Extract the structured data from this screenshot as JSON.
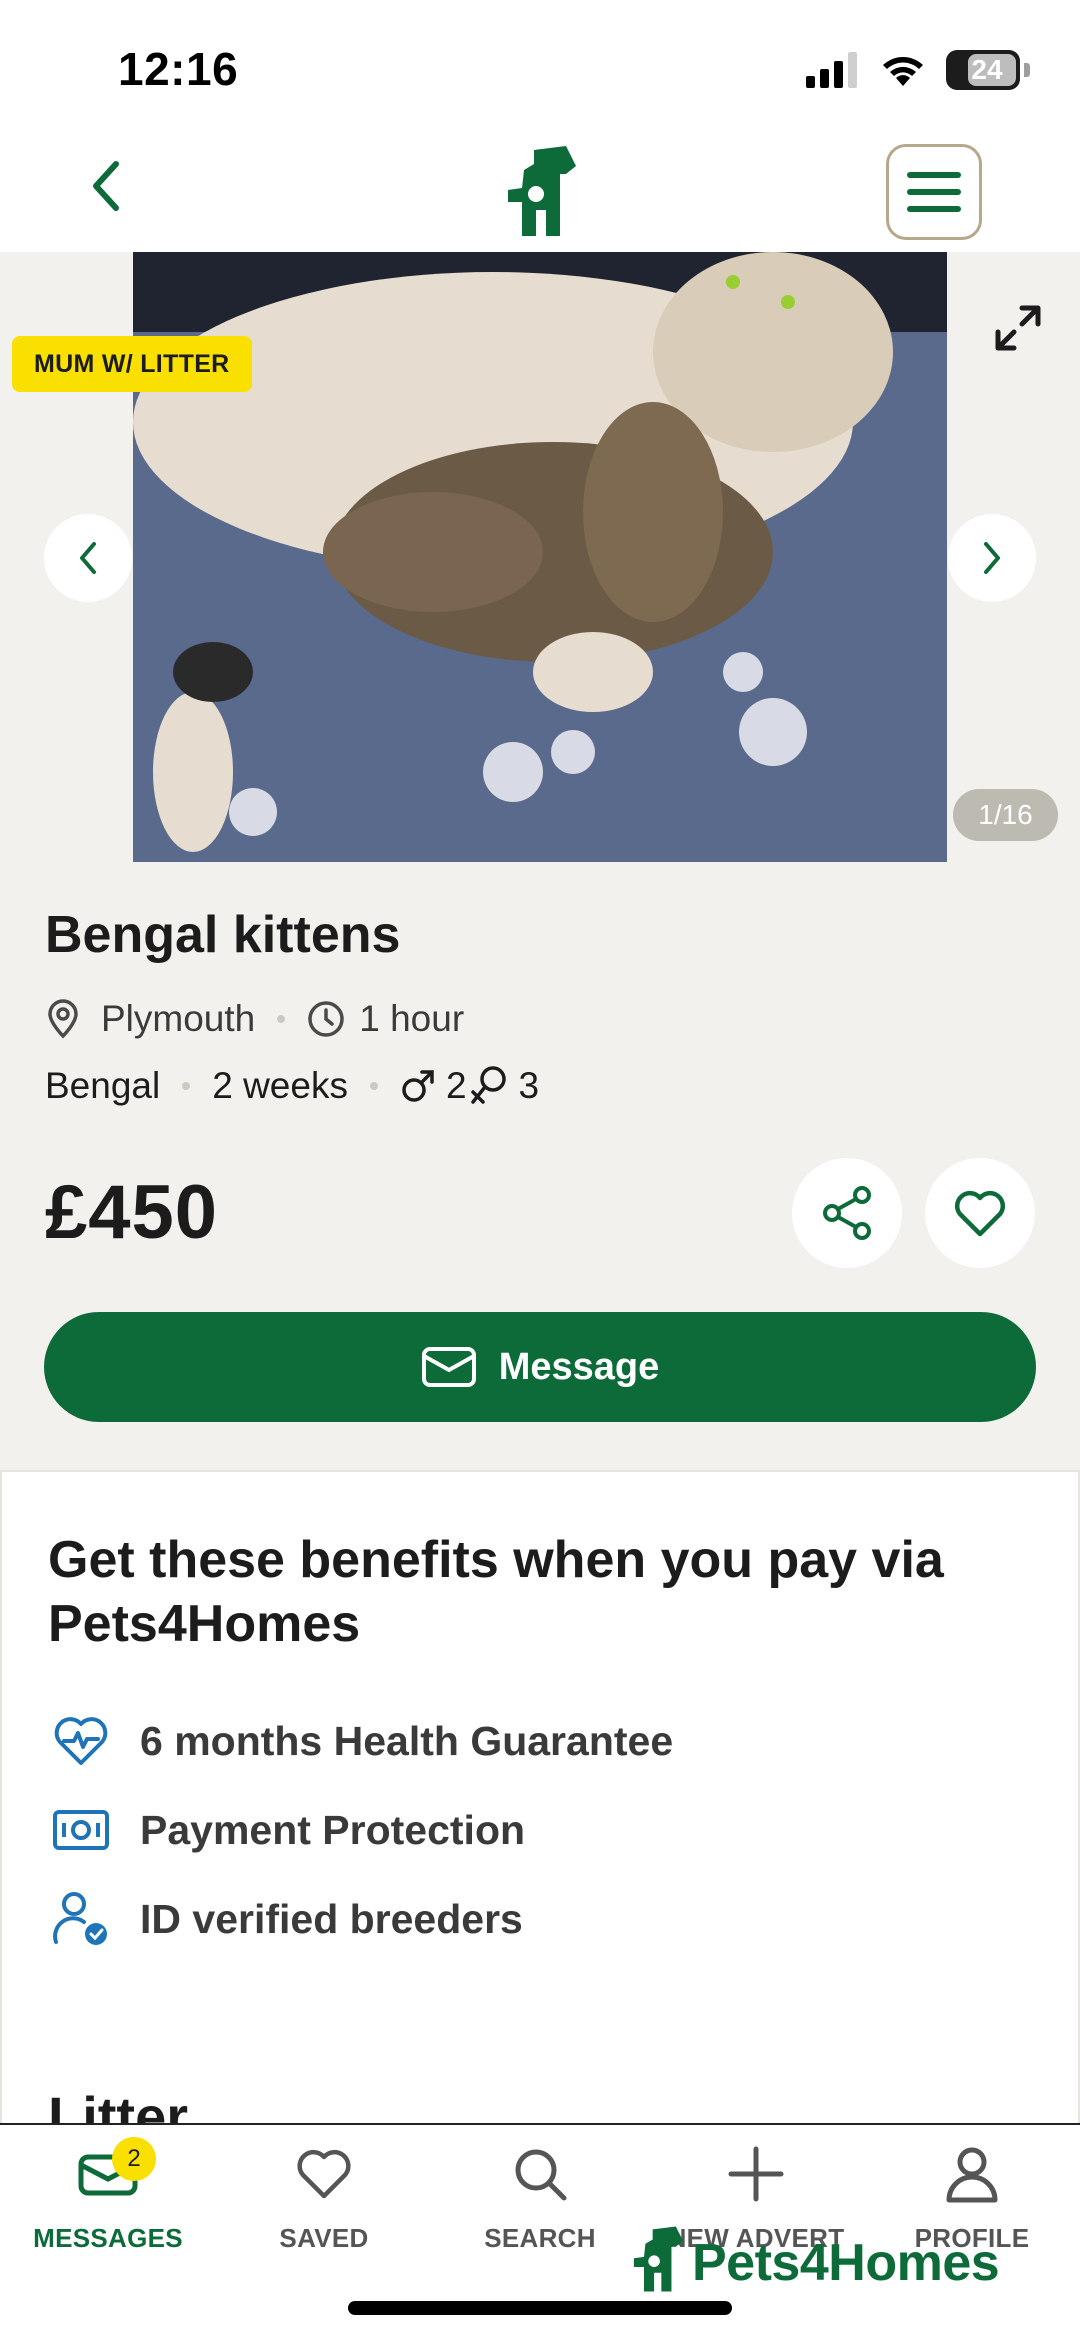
{
  "status_bar": {
    "time": "12:16",
    "battery": "24"
  },
  "listing": {
    "badge": "MUM W/ LITTER",
    "image_counter": "1/16",
    "title": "Bengal kittens",
    "location": "Plymouth",
    "posted": "1 hour",
    "breed": "Bengal",
    "age": "2 weeks",
    "males": "2",
    "females": "3",
    "price": "£450",
    "message_label": "Message"
  },
  "benefits": {
    "title": "Get these benefits when you pay via Pets4Homes",
    "items": [
      {
        "icon": "heart-pulse-icon",
        "label": "6 months Health Guarantee"
      },
      {
        "icon": "banknote-icon",
        "label": "Payment Protection"
      },
      {
        "icon": "verified-user-icon",
        "label": "ID verified breeders"
      }
    ]
  },
  "next_section_heading": "Litter",
  "bottom_nav": {
    "tabs": [
      {
        "label": "MESSAGES",
        "icon": "envelope-icon",
        "badge": "2",
        "active": true
      },
      {
        "label": "SAVED",
        "icon": "heart-icon"
      },
      {
        "label": "SEARCH",
        "icon": "search-icon"
      },
      {
        "label": "NEW ADVERT",
        "icon": "plus-icon"
      },
      {
        "label": "PROFILE",
        "icon": "person-icon"
      }
    ]
  },
  "brand": {
    "name": "Pets4Homes"
  },
  "colors": {
    "brand_green": "#0d6b3a",
    "badge_yellow": "#f9e000",
    "panel_beige": "#f2f1ee",
    "benefit_icon_blue": "#1f74b8"
  }
}
